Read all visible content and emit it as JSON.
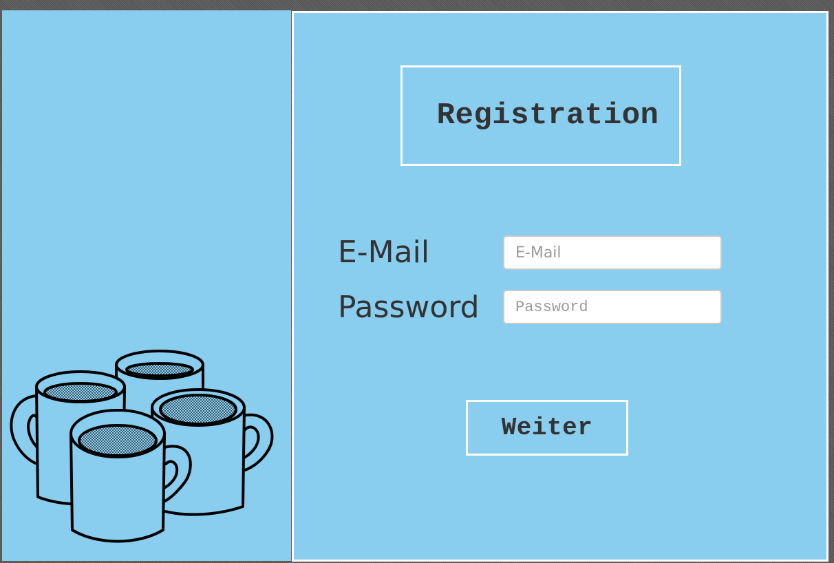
{
  "form": {
    "title": "Registration",
    "email_label": "E-Mail",
    "email_placeholder": "E-Mail",
    "email_value": "",
    "password_label": "Password",
    "password_placeholder": "Password",
    "password_value": "",
    "submit_label": "Weiter"
  },
  "illustration": {
    "icon": "coffee-mugs-icon"
  },
  "colors": {
    "panel_background": "#89cdef",
    "border": "#ffffff",
    "text": "#333333"
  }
}
